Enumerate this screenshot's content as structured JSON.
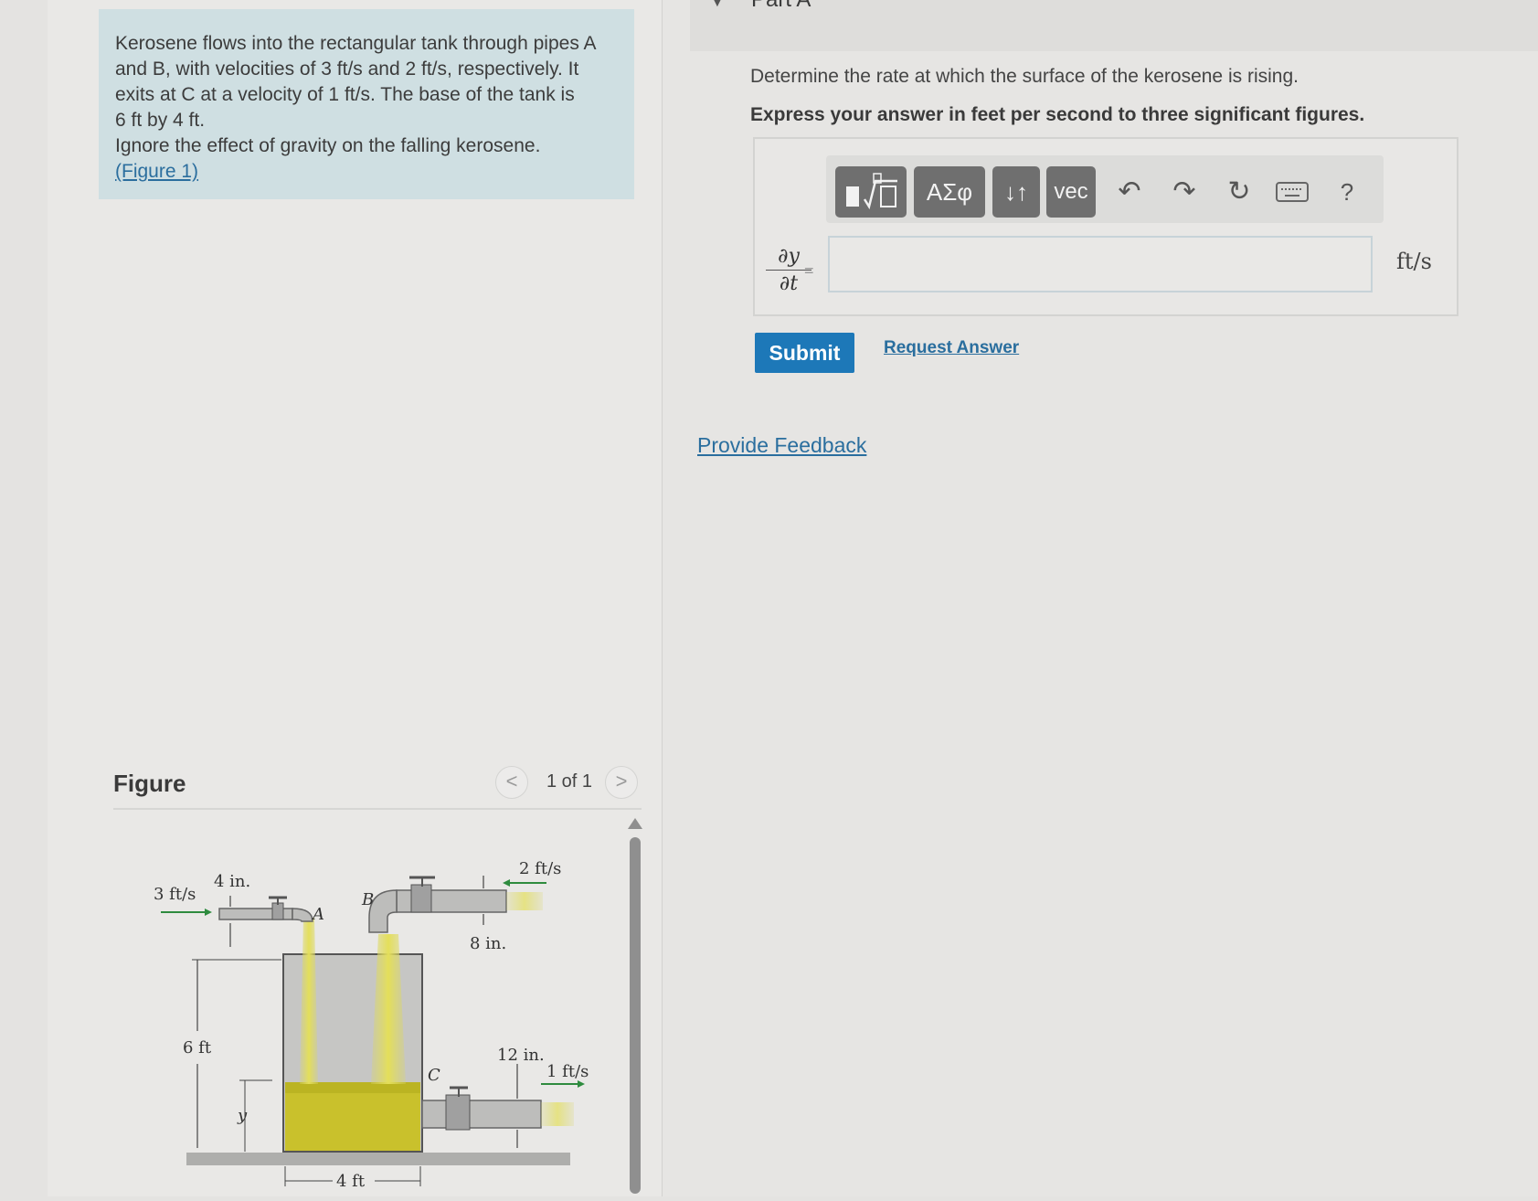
{
  "problem": {
    "line1": "Kerosene flows into the rectangular tank through pipes A",
    "line2": "and B, with velocities of 3 ft/s and 2 ft/s, respectively. It",
    "line3": "exits at C at a velocity of 1 ft/s. The base of the tank is",
    "line4": "6 ft by 4 ft.",
    "line5": "Ignore the effect of gravity on the falling kerosene.",
    "figure_link": "(Figure 1)"
  },
  "figure": {
    "title": "Figure",
    "pager": "1 of 1",
    "prev": "<",
    "next": ">",
    "labels": {
      "vA": "3 ft/s",
      "dA": "4 in.",
      "pipeA": "A",
      "pipeB": "B",
      "vB": "2 ft/s",
      "dB": "8 in.",
      "height": "6 ft",
      "level": "y",
      "pipeC": "C",
      "dC": "12 in.",
      "vC": "1 ft/s",
      "width": "4 ft"
    }
  },
  "part": {
    "title": "Part A",
    "question": "Determine the rate at which the surface of the kerosene is rising.",
    "instruction": "Express your answer in feet per second to three significant figures."
  },
  "toolbar": {
    "templates_icon": "templates-icon",
    "greek": "ΑΣφ",
    "arrows": "↓↑",
    "vec": "vec",
    "undo": "↶",
    "redo": "↷",
    "reset": "↻",
    "keyboard_icon": "keyboard-icon",
    "help": "?"
  },
  "answer": {
    "lhs_num": "∂y",
    "lhs_den": "∂t",
    "equals": "=",
    "value": "",
    "unit": "ft/s"
  },
  "actions": {
    "submit": "Submit",
    "request": "Request Answer",
    "feedback": "Provide Feedback"
  },
  "colors": {
    "accent": "#1d78b8",
    "link": "#2a6e9e",
    "problem_bg": "#cfdfe2",
    "kerosene": "#c8c431"
  }
}
